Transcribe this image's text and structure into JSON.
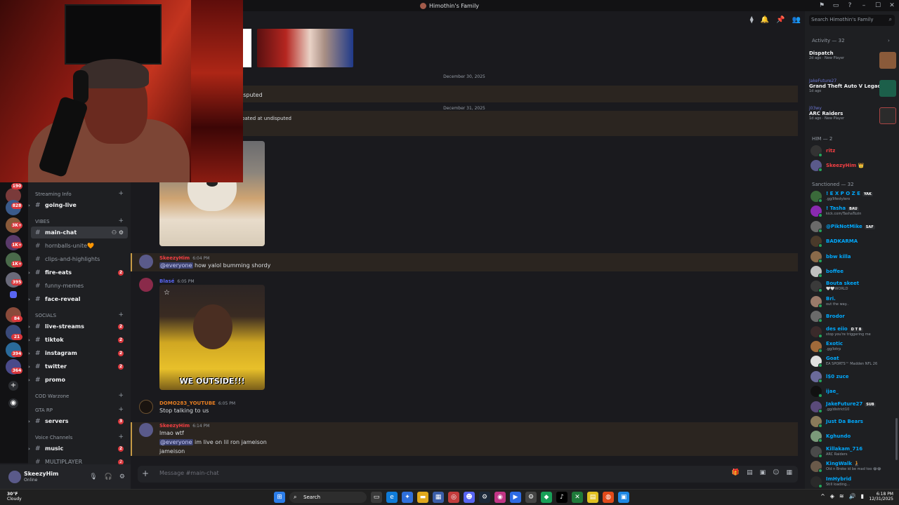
{
  "window": {
    "server_title": "Himothin's Family",
    "controls": [
      "–",
      "☐",
      "✕"
    ]
  },
  "search": {
    "placeholder": "Search Himothin's Family"
  },
  "rail": {
    "badges": [
      "190",
      "828",
      "3K+",
      "1K+",
      "1K+",
      "395",
      "84",
      "21",
      "394",
      "364"
    ]
  },
  "sidebar": {
    "categories": {
      "streaming": "Streaming Info",
      "vibes": "VIBES",
      "socials": "SOCIALS",
      "cod": "COD Warzone",
      "gtarp": "GTA RP",
      "voice": "Voice Channels"
    },
    "channels": [
      {
        "name": "going-live",
        "badge": ""
      },
      {
        "name": "main-chat",
        "badge": ""
      },
      {
        "name": "hornballs-unite🧡",
        "badge": ""
      },
      {
        "name": "clips-and-highlights",
        "badge": ""
      },
      {
        "name": "fire-eats",
        "badge": "2"
      },
      {
        "name": "funny-memes",
        "badge": ""
      },
      {
        "name": "face-reveal",
        "badge": ""
      },
      {
        "name": "live-streams",
        "badge": "2"
      },
      {
        "name": "tiktok",
        "badge": "2"
      },
      {
        "name": "instagram",
        "badge": "2"
      },
      {
        "name": "twitter",
        "badge": "2"
      },
      {
        "name": "promo",
        "badge": ""
      },
      {
        "name": "servers",
        "badge": "3"
      },
      {
        "name": "music",
        "badge": "2"
      },
      {
        "name": "MULTIPLAYER",
        "badge": "2"
      }
    ]
  },
  "user": {
    "name": "SkeezyHim",
    "status": "Online"
  },
  "chat": {
    "dates": [
      "December 30, 2025",
      "December 31, 2025"
    ],
    "fragments": [
      "isputed",
      "pated at undisputed"
    ],
    "messages": [
      {
        "author": "SkeezyHim",
        "time": "6:04 PM",
        "mention": "@everyone",
        "text": "how yalol bumming shordy",
        "color": "#f23f43"
      },
      {
        "author": "Blasé",
        "time": "6:05 PM",
        "caption": "WE OUTSIDE!!!",
        "color": "#5865f2"
      },
      {
        "author": "DOMO283_YOUTUBE",
        "time": "6:05 PM",
        "text": "Stop talking to us",
        "color": "#e67e22"
      },
      {
        "author": "SkeezyHim",
        "time": "6:14 PM",
        "line1": "lmao wtf",
        "mention": "@everyone",
        "line2": "im live on lil ron jameison",
        "line3": "jameison",
        "color": "#f23f43"
      }
    ],
    "composer_placeholder": "Message #main-chat"
  },
  "members": {
    "activity_header": "Activity — 32",
    "activities": [
      {
        "user": "",
        "game": "Dispatch",
        "meta": "2d ago",
        "tag": "New Player",
        "color": "#8a5a3a"
      },
      {
        "user": "JakeFuture27",
        "game": "Grand Theft Auto V Legacy",
        "meta": "1d ago",
        "tag": "",
        "color": "#1c5f4a"
      },
      {
        "user": "j03wy",
        "game": "ARC Raiders",
        "meta": "1d ago",
        "tag": "New Player",
        "color": "#2b2b2b"
      }
    ],
    "him_header": "HIM — 2",
    "him": [
      {
        "name": "ritz",
        "sub": "",
        "color": "#f23f43",
        "av": "#333"
      },
      {
        "name": "SkeezyHim 👑",
        "sub": "",
        "color": "#f23f43",
        "av": "#5a5a8a"
      }
    ],
    "sanctioned_header": "Sanctioned — 32",
    "sanctioned": [
      {
        "name": "! E X P O Z E",
        "tag": "YAK",
        "sub": ".gg/lifestylero",
        "color": "#00a8fc",
        "av": "#3a6a3a"
      },
      {
        "name": "! Tasha",
        "tag": "BAU",
        "sub": "kick.com/TashaTozin",
        "color": "#00a8fc",
        "av": "#8a2ab0"
      },
      {
        "name": "@PikNotMike",
        "tag": "SAF",
        "sub": "",
        "color": "#00a8fc",
        "av": "#6a6a6a"
      },
      {
        "name": "BADKARMA",
        "tag": "",
        "sub": "",
        "color": "#00a8fc",
        "av": "#4a3a2a"
      },
      {
        "name": "bbw killa",
        "tag": "",
        "sub": "",
        "color": "#00a8fc",
        "av": "#8a6a4a"
      },
      {
        "name": "boffee",
        "tag": "",
        "sub": "",
        "color": "#00a8fc",
        "av": "#c0c0c0"
      },
      {
        "name": "Bouta skeet",
        "tag": "",
        "sub": "🤍🤍WORLD",
        "color": "#00a8fc",
        "av": "#3a3a3a"
      },
      {
        "name": "Bri.",
        "tag": "",
        "sub": "out the way..",
        "color": "#00a8fc",
        "av": "#9a7a6a"
      },
      {
        "name": "Brodor",
        "tag": "",
        "sub": "",
        "color": "#00a8fc",
        "av": "#6a6a6a"
      },
      {
        "name": "des eiio",
        "tag": "D T B",
        "sub": "stop you're triggering me",
        "color": "#00a8fc",
        "av": "#3a2a2a"
      },
      {
        "name": "Exotic",
        "tag": "",
        "sub": ".gg/lotrp",
        "color": "#00a8fc",
        "av": "#a06a3a"
      },
      {
        "name": "Goat",
        "tag": "",
        "sub": "EA SPORTS™ Madden NFL 26",
        "color": "#00a8fc",
        "av": "#e0e0e0"
      },
      {
        "name": "l$0 zuce",
        "tag": "",
        "sub": "",
        "color": "#00a8fc",
        "av": "#6a6a9a"
      },
      {
        "name": "ijae_",
        "tag": "",
        "sub": "",
        "color": "#00a8fc",
        "av": "#111"
      },
      {
        "name": "JakeFuture27",
        "tag": "SUB",
        "sub": ".gg/district10",
        "color": "#00a8fc",
        "av": "#5a4a7a"
      },
      {
        "name": "Just Da Bears",
        "tag": "",
        "sub": "",
        "color": "#00a8fc",
        "av": "#8a7a5a"
      },
      {
        "name": "Kghundo",
        "tag": "",
        "sub": "",
        "color": "#00a8fc",
        "av": "#7a9a7a"
      },
      {
        "name": "Killakam_716",
        "tag": "",
        "sub": "ARC Raiders",
        "color": "#00a8fc",
        "av": "#4a4a4a"
      },
      {
        "name": "KingWalk 🧎",
        "tag": "",
        "sub": "Old n Broke id be mad too 😂😂",
        "color": "#00a8fc",
        "av": "#6a5a4a"
      },
      {
        "name": "ImHybrid",
        "tag": "",
        "sub": "Still loading...",
        "color": "#00a8fc",
        "av": "#2a2a2a"
      }
    ]
  },
  "taskbar": {
    "temp": "30°F",
    "weather": "Cloudy",
    "search": "Search",
    "time": "6:18 PM",
    "date": "12/31/2025"
  }
}
